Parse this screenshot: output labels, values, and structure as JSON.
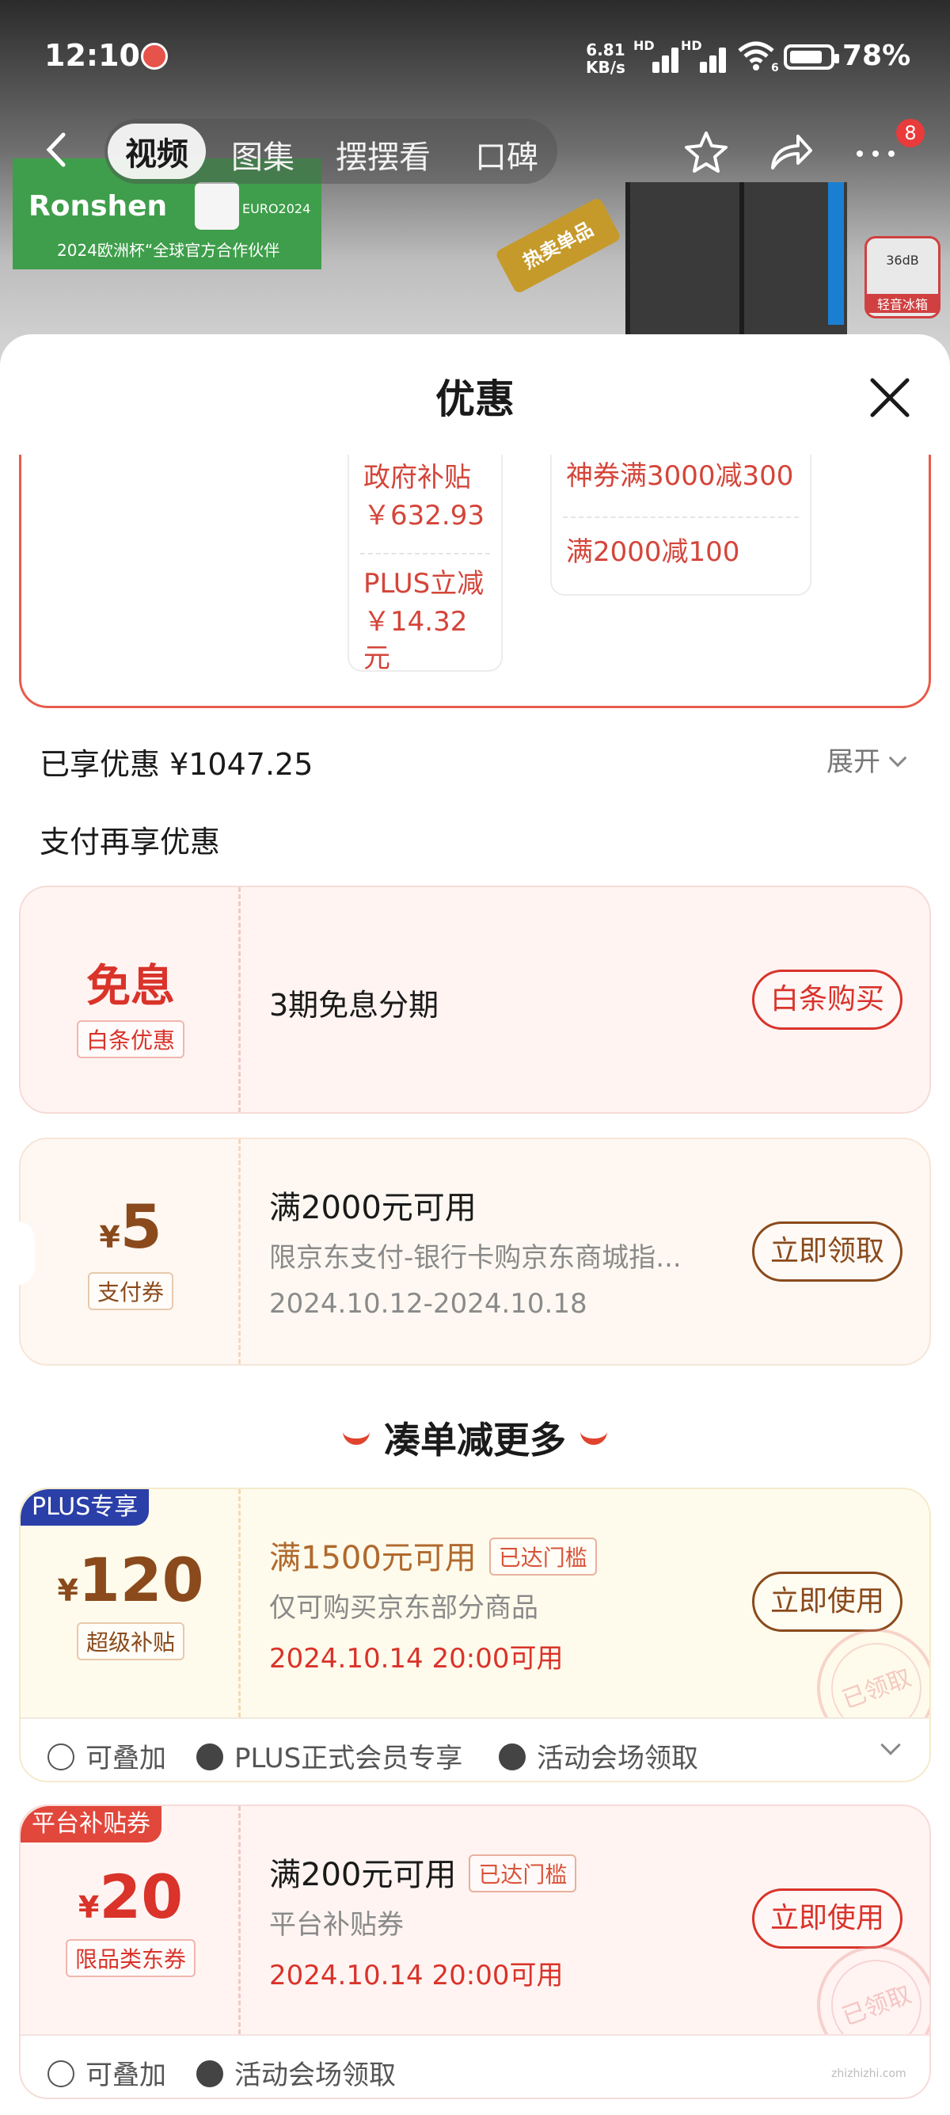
{
  "status_bar": {
    "time": "12:10",
    "net_speed_value": "6.81",
    "net_speed_unit": "KB/s",
    "signal_label": "HD",
    "wifi_label": "6",
    "battery": "78%"
  },
  "top_nav": {
    "tabs": [
      "视频",
      "图集",
      "摆摆看",
      "口碑"
    ],
    "active_tab": 0,
    "more_badge": "8"
  },
  "background": {
    "brand": "Ronshen",
    "euro_label": "EURO2024",
    "brand_sub": "2024欧洲杯“全球官方合作伙伴",
    "hot_tag": "热卖单品",
    "quiet_badge_top": "36dB",
    "quiet_badge": "轻音冰箱"
  },
  "sheet": {
    "title": "优惠"
  },
  "summary_card": {
    "left_box": [
      {
        "label": "政府补贴",
        "value": "￥632.93"
      },
      {
        "label": "PLUS立减",
        "value": "￥14.32元"
      }
    ],
    "right_box": [
      "神券满3000减300",
      "满2000减100"
    ]
  },
  "enjoyed": {
    "label": "已享优惠 ¥1047.25",
    "expand": "展开"
  },
  "pay_more_title": "支付再享优惠",
  "coupons": [
    {
      "big": "免息",
      "tag": "白条优惠",
      "title": "3期免息分期",
      "button": "白条购买"
    },
    {
      "currency": "¥",
      "amount": "5",
      "tag": "支付券",
      "title": "满2000元可用",
      "desc": "限京东支付-银行卡购京东商城指...",
      "date": "2024.10.12-2024.10.18",
      "button": "立即领取"
    }
  ],
  "more_title": "凑单减更多",
  "more_coupons": [
    {
      "corner": "PLUS专享",
      "currency": "¥",
      "amount": "120",
      "tag": "超级补贴",
      "title": "满1500元可用",
      "reached": "已达门槛",
      "desc": "仅可购买京东部分商品",
      "date": "2024.10.14 20:00可用",
      "button": "立即使用",
      "stamp": "已领取",
      "features": [
        "可叠加",
        "PLUS正式会员专享",
        "活动会场领取"
      ]
    },
    {
      "corner": "平台补贴券",
      "currency": "¥",
      "amount": "20",
      "tag": "限品类东券",
      "title": "满200元可用",
      "reached": "已达门槛",
      "desc": "平台补贴券",
      "date": "2024.10.14 20:00可用",
      "button": "立即使用",
      "stamp": "已领取",
      "features": [
        "可叠加",
        "活动会场领取"
      ]
    }
  ],
  "watermark": "zhizhizhi.com",
  "colors": {
    "accent_red": "#d9332a",
    "brown": "#8a4a1c",
    "plus_blue": "#2a3fa8"
  }
}
